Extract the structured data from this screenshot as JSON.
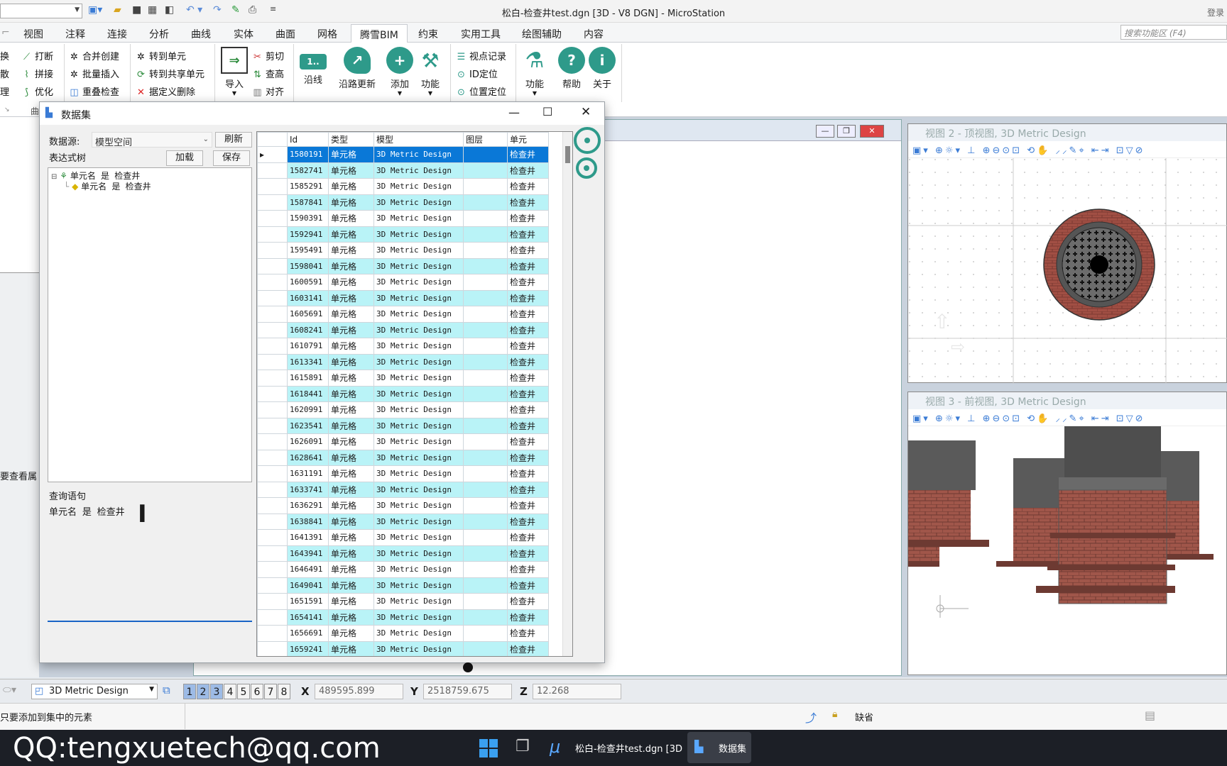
{
  "window": {
    "title": "松白-检查井test.dgn [3D - V8 DGN] - MicroStation",
    "login": "登录"
  },
  "ribbon_tabs": [
    "视图",
    "注释",
    "连接",
    "分析",
    "曲线",
    "实体",
    "曲面",
    "网格",
    "腾雪BIM",
    "约束",
    "实用工具",
    "绘图辅助",
    "内容"
  ],
  "search_placeholder": "搜索功能区 (F4)",
  "ribbon": {
    "left_cut": [
      "换",
      "散",
      "理"
    ],
    "col1": [
      "打断",
      "拼接",
      "优化"
    ],
    "col2": [
      "合并创建",
      "批量插入",
      "重叠检查"
    ],
    "col3": [
      "转到单元",
      "转到共享单元",
      "据定义删除"
    ],
    "import": "导入",
    "col4": [
      "剪切",
      "查高",
      "对齐"
    ],
    "along": "沿线",
    "along_update": "沿路更新",
    "add": "添加",
    "func": "功能",
    "col5": [
      "视点记录",
      "ID定位",
      "位置定位"
    ],
    "func2": "功能",
    "help": "帮助",
    "about": "关于",
    "group_label": "曲"
  },
  "dialog": {
    "title": "数据集",
    "source_label": "数据源:",
    "source_value": "模型空间",
    "refresh": "刷新",
    "expr_label": "表达式树",
    "load": "加载",
    "save": "保存",
    "tree_root": "单元名 是 检查井",
    "tree_child": "单元名 是 检查井",
    "query_label": "查询语句",
    "query_text": "单元名 是 检查井",
    "columns": [
      "Id",
      "类型",
      "模型",
      "图层",
      "单元"
    ],
    "row_type": "单元格",
    "row_model": "3D Metric Design",
    "row_cell": "检查井",
    "ids": [
      "1580191",
      "1582741",
      "1585291",
      "1587841",
      "1590391",
      "1592941",
      "1595491",
      "1598041",
      "1600591",
      "1603141",
      "1605691",
      "1608241",
      "1610791",
      "1613341",
      "1615891",
      "1618441",
      "1620991",
      "1623541",
      "1626091",
      "1628641",
      "1631191",
      "1633741",
      "1636291",
      "1638841",
      "1641391",
      "1643941",
      "1646491",
      "1649041",
      "1651591",
      "1654141",
      "1656691",
      "1659241"
    ]
  },
  "views": {
    "v2_title": "视图 2 - 顶视图, 3D Metric Design",
    "v3_title": "视图 3 - 前视图, 3D Metric Design"
  },
  "left_stub_text": "要查看属",
  "status": {
    "model": "3D Metric Design",
    "view_nums": [
      "1",
      "2",
      "3",
      "4",
      "5",
      "6",
      "7",
      "8"
    ],
    "x_label": "X",
    "x": "489595.899",
    "y_label": "Y",
    "y": "2518759.675",
    "z_label": "Z",
    "z": "12.268",
    "prompt": "只要添加到集中的元素",
    "default_label": "缺省"
  },
  "taskbar": {
    "qq": "QQ:tengxuetech@qq.com",
    "app1": "松白-检查井test.dgn [3D",
    "app2": "数据集"
  }
}
